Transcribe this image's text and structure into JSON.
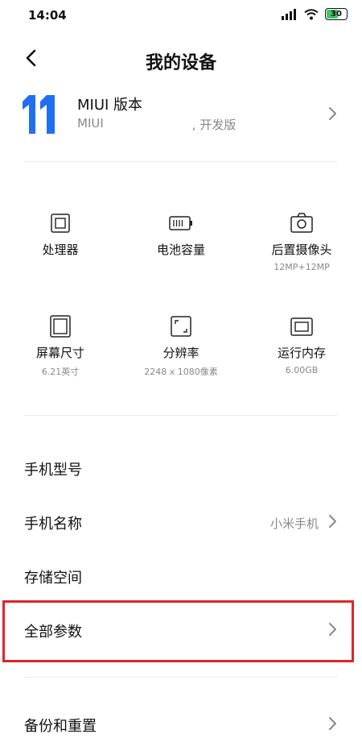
{
  "status": {
    "time": "14:04",
    "battery": "30"
  },
  "header": {
    "title": "我的设备"
  },
  "miui": {
    "title": "MIUI 版本",
    "prefix": "MIUI",
    "suffix": ", 开发版"
  },
  "specs": [
    {
      "label": "处理器",
      "value": ""
    },
    {
      "label": "电池容量",
      "value": ""
    },
    {
      "label": "后置摄像头",
      "value": "12MP+12MP"
    },
    {
      "label": "屏幕尺寸",
      "value": "6.21英寸"
    },
    {
      "label": "分辨率",
      "value": "2248 x 1080像素"
    },
    {
      "label": "运行内存",
      "value": "6.00GB"
    }
  ],
  "rows": {
    "model": {
      "label": "手机型号",
      "value": ""
    },
    "name": {
      "label": "手机名称",
      "value": "小米手机"
    },
    "storage": {
      "label": "存储空间",
      "value": ""
    },
    "all_params": {
      "label": "全部参数"
    },
    "backup": {
      "label": "备份和重置"
    }
  },
  "colors": {
    "accent": "#1f6ff2",
    "highlight": "#e0242a",
    "battery": "#45c26a"
  }
}
